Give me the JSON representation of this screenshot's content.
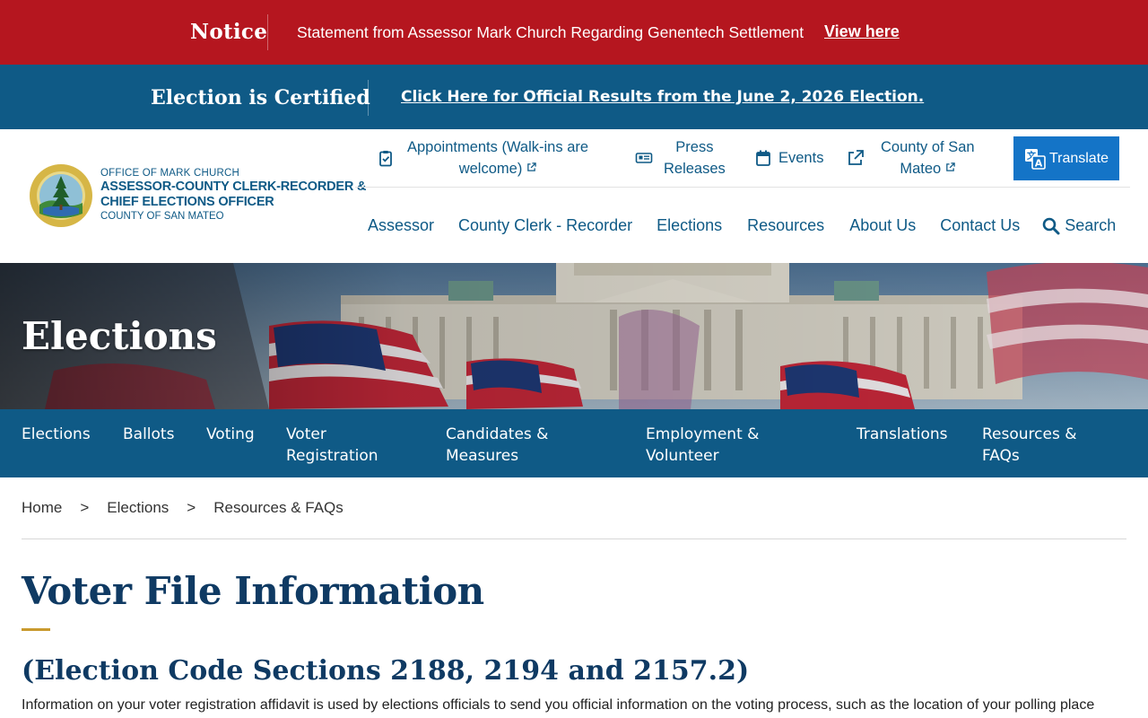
{
  "notice": {
    "label": "Notice",
    "text": "Statement from Assessor Mark Church Regarding Genentech Settlement",
    "link": "View here"
  },
  "election_banner": {
    "label": "Election is Certified",
    "link": "Click Here for Official Results from the June 2, 2026 Election."
  },
  "logo": {
    "line1": "OFFICE OF MARK CHURCH",
    "line2": "ASSESSOR-COUNTY CLERK-RECORDER &",
    "line3": "CHIEF ELECTIONS OFFICER",
    "line4": "COUNTY OF SAN MATEO"
  },
  "utility_nav": {
    "appointments_line1": "Appointments (Walk-ins are",
    "appointments_line2": "welcome)",
    "press_line1": "Press",
    "press_line2": "Releases",
    "events": "Events",
    "county_line1": "County of San",
    "county_line2": "Mateo",
    "translate": "Translate"
  },
  "main_nav": {
    "assessor": "Assessor",
    "county_clerk": "County Clerk - Recorder",
    "elections": "Elections",
    "resources": "Resources",
    "about": "About Us",
    "contact": "Contact Us",
    "search": "Search"
  },
  "hero": {
    "title": "Elections"
  },
  "section_nav": {
    "elections": "Elections",
    "ballots": "Ballots",
    "voting": "Voting",
    "voter_reg_1": "Voter",
    "voter_reg_2": "Registration",
    "candidates_1": "Candidates &",
    "candidates_2": "Measures",
    "employment_1": "Employment &",
    "employment_2": "Volunteer",
    "translations": "Translations",
    "resources_1": "Resources &",
    "resources_2": "FAQs"
  },
  "breadcrumb": {
    "home": "Home",
    "sep": ">",
    "elections": "Elections",
    "current": "Resources & FAQs"
  },
  "page": {
    "title": "Voter File Information",
    "subtitle": "(Election Code Sections 2188, 2194 and 2157.2)",
    "intro": "Information on your voter registration affidavit is used by elections officials to send you official information on the voting process, such as the location of your polling place"
  },
  "colors": {
    "notice_red": "#b5161f",
    "brand_blue": "#0f5a86",
    "translate_blue": "#1474c7",
    "heading_navy": "#0f3a63",
    "accent_gold": "#c99a2e"
  },
  "icons": {
    "appointments": "clipboard-check-icon",
    "press": "newspaper-icon",
    "events": "calendar-icon",
    "county": "external-link-icon",
    "translate": "translate-icon",
    "search": "search-icon"
  }
}
